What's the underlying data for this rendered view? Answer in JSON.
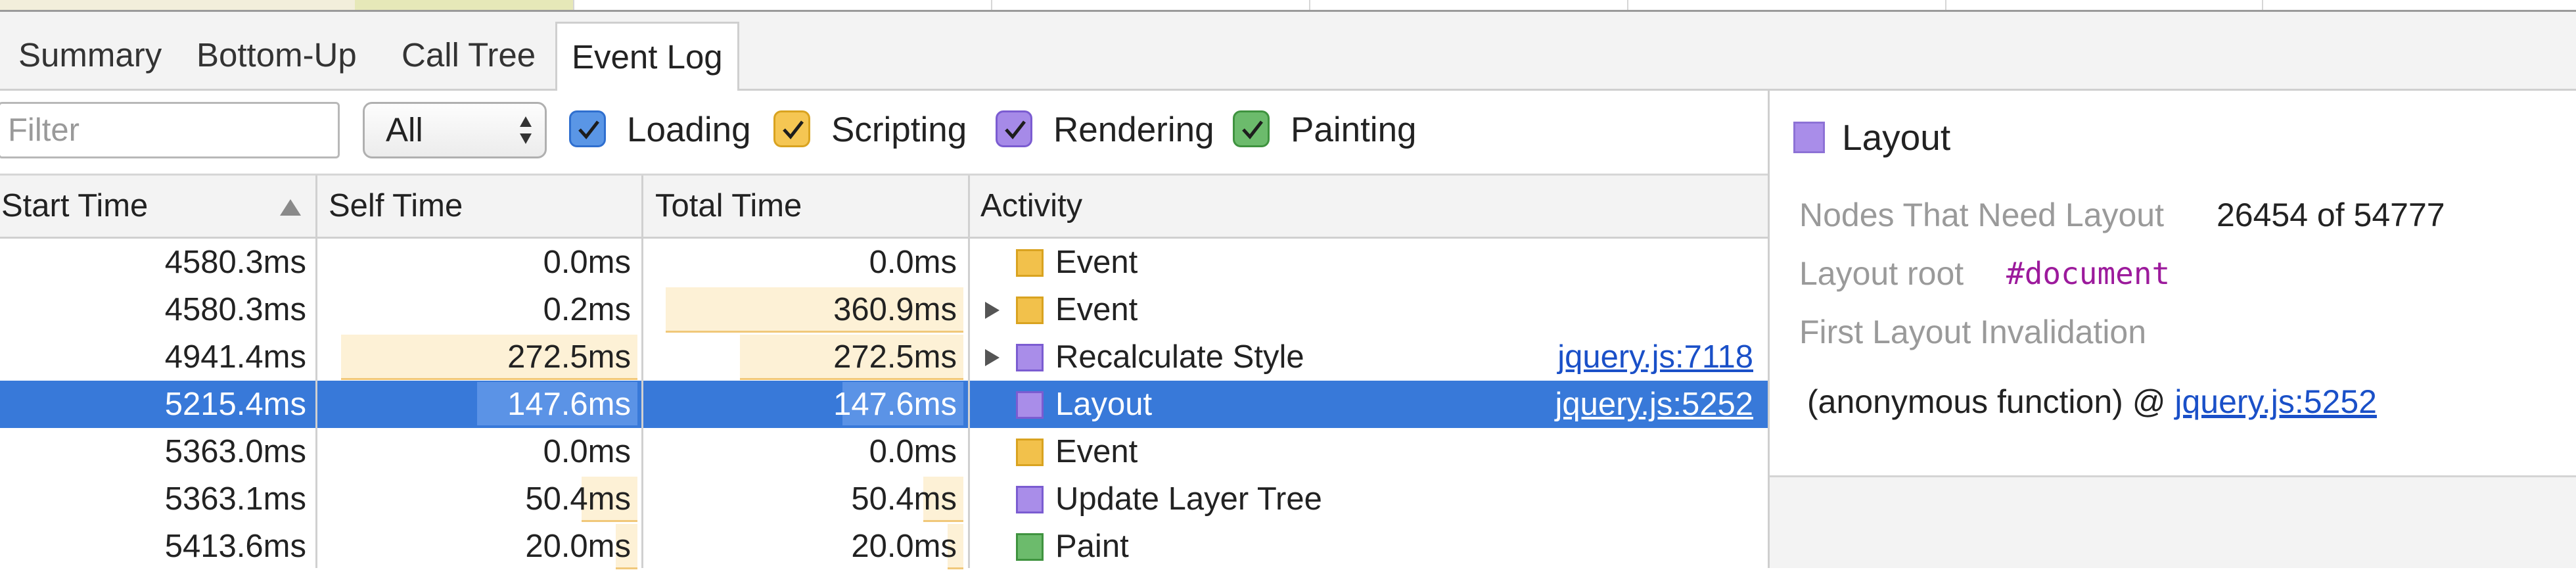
{
  "tabs": [
    {
      "label": "Summary",
      "active": false
    },
    {
      "label": "Bottom-Up",
      "active": false
    },
    {
      "label": "Call Tree",
      "active": false
    },
    {
      "label": "Event Log",
      "active": true
    }
  ],
  "toolbar": {
    "filter_placeholder": "Filter",
    "filter_value": "",
    "duration_select": "All",
    "categories": [
      {
        "label": "Loading",
        "checked": true,
        "color": "#4e8de0"
      },
      {
        "label": "Scripting",
        "checked": true,
        "color": "#f2c14b"
      },
      {
        "label": "Rendering",
        "checked": true,
        "color": "#9d7fe8"
      },
      {
        "label": "Painting",
        "checked": true,
        "color": "#5fb35f"
      }
    ]
  },
  "table": {
    "columns": [
      "Start Time",
      "Self Time",
      "Total Time",
      "Activity"
    ],
    "sort": {
      "column": "Start Time",
      "direction": "ascending"
    },
    "rows": [
      {
        "start": "4580.3ms",
        "self": "0.0ms",
        "total": "0.0ms",
        "activity": "Event",
        "category": "scripting",
        "expandable": false,
        "link": "",
        "selected": false,
        "self_fraction": 0,
        "total_fraction": 0
      },
      {
        "start": "4580.3ms",
        "self": "0.2ms",
        "total": "360.9ms",
        "activity": "Event",
        "category": "scripting",
        "expandable": true,
        "link": "",
        "selected": false,
        "self_fraction": 0.001,
        "total_fraction": 0.96
      },
      {
        "start": "4941.4ms",
        "self": "272.5ms",
        "total": "272.5ms",
        "activity": "Recalculate Style",
        "category": "rendering",
        "expandable": true,
        "link": "jquery.js:7118",
        "selected": false,
        "self_fraction": 0.96,
        "total_fraction": 0.72
      },
      {
        "start": "5215.4ms",
        "self": "147.6ms",
        "total": "147.6ms",
        "activity": "Layout",
        "category": "rendering",
        "expandable": false,
        "link": "jquery.js:5252",
        "selected": true,
        "self_fraction": 0.52,
        "total_fraction": 0.39
      },
      {
        "start": "5363.0ms",
        "self": "0.0ms",
        "total": "0.0ms",
        "activity": "Event",
        "category": "scripting",
        "expandable": false,
        "link": "",
        "selected": false,
        "self_fraction": 0,
        "total_fraction": 0
      },
      {
        "start": "5363.1ms",
        "self": "50.4ms",
        "total": "50.4ms",
        "activity": "Update Layer Tree",
        "category": "rendering",
        "expandable": false,
        "link": "",
        "selected": false,
        "self_fraction": 0.18,
        "total_fraction": 0.13
      },
      {
        "start": "5413.6ms",
        "self": "20.0ms",
        "total": "20.0ms",
        "activity": "Paint",
        "category": "painting",
        "expandable": false,
        "link": "",
        "selected": false,
        "self_fraction": 0.07,
        "total_fraction": 0.05
      }
    ]
  },
  "details": {
    "title": "Layout",
    "color": "#a98de9",
    "nodes_label": "Nodes That Need Layout",
    "nodes_value": "26454 of 54777",
    "root_label": "Layout root",
    "root_value": "#document",
    "invalidation_label": "First Layout Invalidation",
    "invalidation_func": "(anonymous function) @ ",
    "invalidation_link": "jquery.js:5252"
  }
}
